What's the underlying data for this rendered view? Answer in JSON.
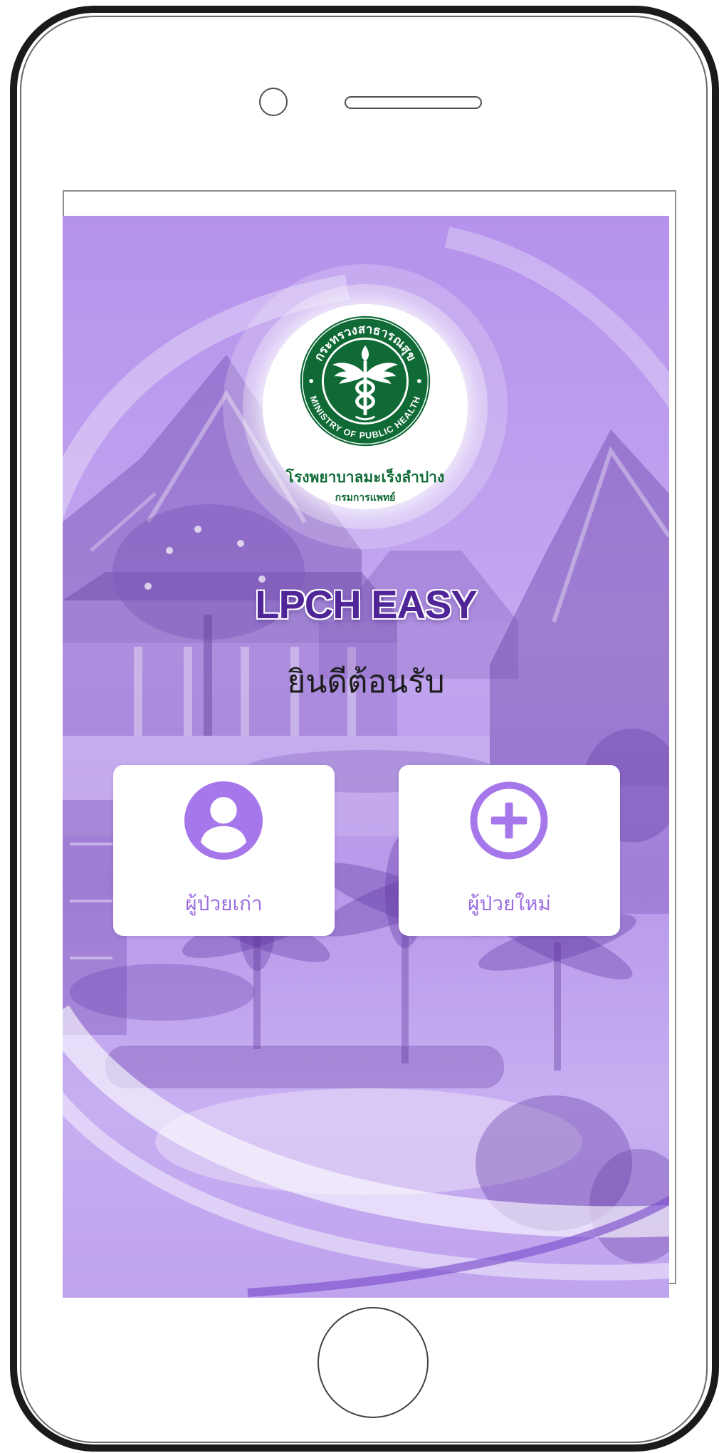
{
  "screen": {
    "logo": {
      "seal_top_text": "กระทรวงสาธารณสุข",
      "seal_bottom_text": "MINISTRY OF PUBLIC HEALTH",
      "hospital_name": "โรงพยาบาลมะเร็งลำปาง",
      "department": "กรมการแพทย์"
    },
    "app_title": "LPCH EASY",
    "welcome": "ยินดีต้อนรับ",
    "options": [
      {
        "label": "ผู้ป่วยเก่า",
        "icon": "user-circle-icon"
      },
      {
        "label": "ผู้ป่วยใหม่",
        "icon": "plus-circle-icon"
      }
    ]
  },
  "theme": {
    "accent": "#a677ea",
    "label": "#9b6ddf",
    "title": "#4f2597",
    "seal_green": "#0f6a36",
    "screen_base": "#bb9cee"
  }
}
